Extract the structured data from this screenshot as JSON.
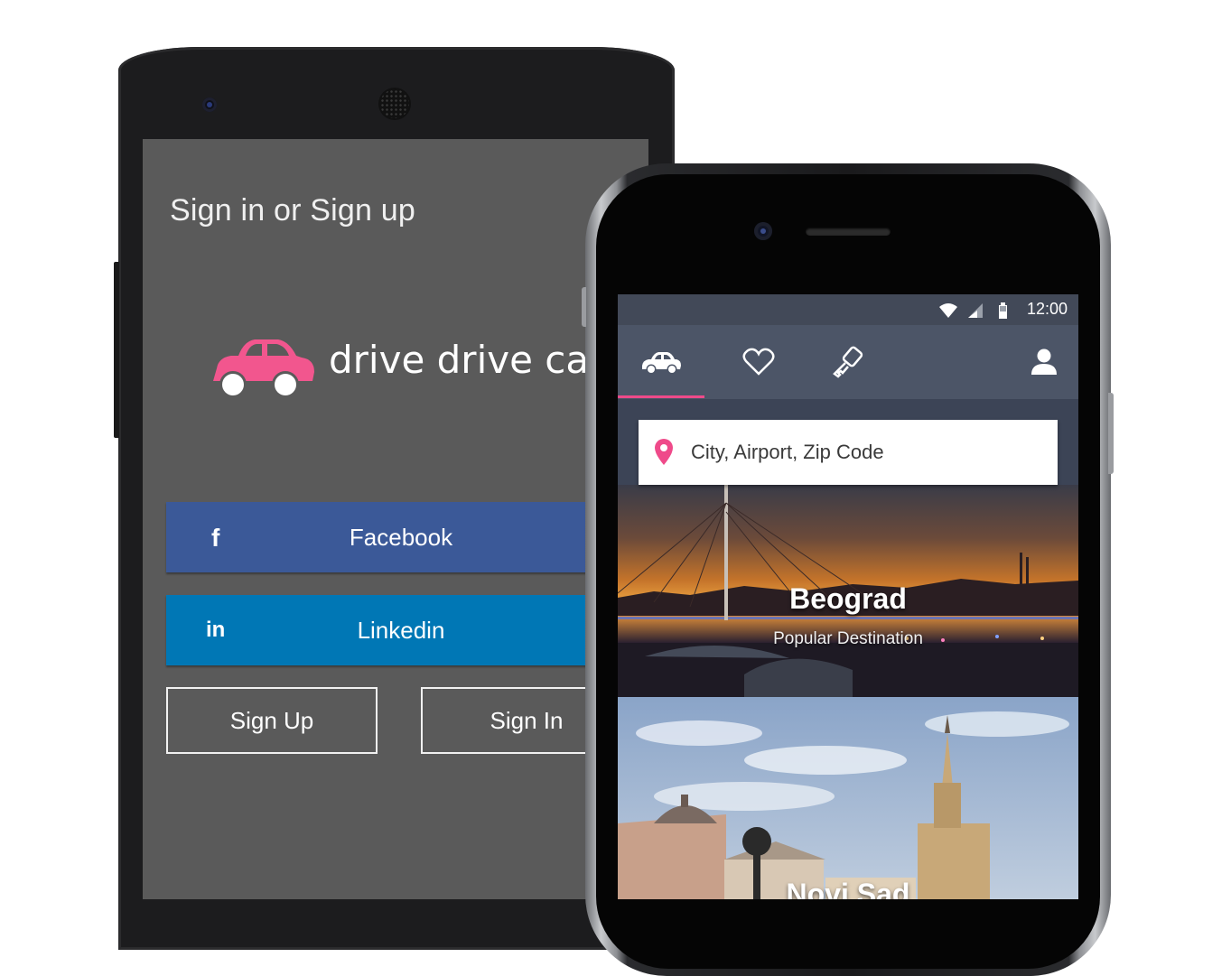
{
  "android": {
    "title": "Sign in or Sign up",
    "brand": "drive drive car",
    "facebook_icon": "f",
    "facebook_label": "Facebook",
    "linkedin_icon": "in",
    "linkedin_label": "Linkedin",
    "signup_label": "Sign Up",
    "signin_label": "Sign In",
    "accent_color": "#f2568e",
    "facebook_color": "#3b5998",
    "linkedin_color": "#0077b5"
  },
  "iphone": {
    "status": {
      "time": "12:00",
      "icons": [
        "wifi-icon",
        "signal-icon",
        "battery-icon"
      ]
    },
    "nav": {
      "tabs": [
        "car-icon",
        "heart-icon",
        "key-icon"
      ],
      "profile": "user-icon",
      "active_tab": "car-icon"
    },
    "search": {
      "placeholder": "City, Airport, Zip Code",
      "icon": "location-pin-icon"
    },
    "destinations": [
      {
        "name": "Beograd",
        "subtitle": "Popular Destination"
      },
      {
        "name": "Novi Sad"
      }
    ]
  }
}
